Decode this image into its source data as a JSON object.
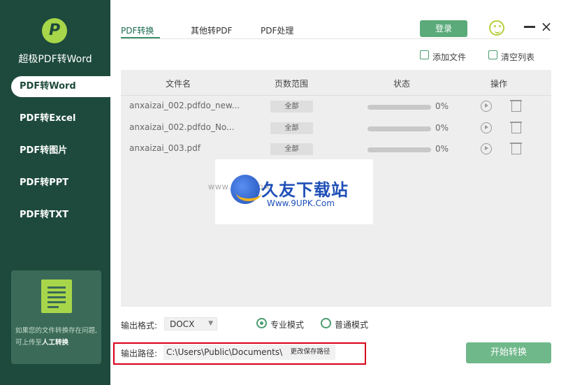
{
  "app": {
    "title": "超极PDF转Word",
    "logo_icon": "pdf-logo-icon",
    "brand_color": "#1d4a3c",
    "accent_color": "#5aaa7a"
  },
  "sidebar": {
    "items": [
      {
        "label": "PDF转Word",
        "active": true
      },
      {
        "label": "PDF转Excel",
        "active": false
      },
      {
        "label": "PDF转图片",
        "active": false
      },
      {
        "label": "PDF转PPT",
        "active": false
      },
      {
        "label": "PDF转TXT",
        "active": false
      }
    ],
    "promo": {
      "text": "如果您的文件转换存在问题,可上传至",
      "link": "人工转换",
      "icon": "document-icon"
    }
  },
  "header": {
    "tabs": [
      {
        "label": "PDF转换",
        "active": true
      },
      {
        "label": "其他转PDF",
        "active": false
      },
      {
        "label": "PDF处理",
        "active": false
      }
    ],
    "login_label": "登录",
    "feedback_icon": "smiley-icon",
    "minimize_icon": "minimize-icon",
    "close_icon": "close-icon"
  },
  "toolbar": {
    "add_file_label": "添加文件",
    "clear_list_label": "清空列表"
  },
  "table": {
    "columns": [
      "文件名",
      "页数范围",
      "状态",
      "操作"
    ],
    "rows": [
      {
        "name": "anxaizai_002.pdfdo_new...",
        "range": "全部",
        "progress": 0,
        "progress_text": "0%"
      },
      {
        "name": "anxaizai_002.pdfdo_No...",
        "range": "全部",
        "progress": 0,
        "progress_text": "0%"
      },
      {
        "name": "anxaizai_003.pdf",
        "range": "全部",
        "progress": 0,
        "progress_text": "0%"
      }
    ]
  },
  "watermark": {
    "left_text": "WWW.9UPK.COM",
    "main_text": "久友下载站",
    "sub_text": "Www.9UPK.Com"
  },
  "output": {
    "format_label": "输出格式:",
    "format_value": "DOCX",
    "mode_pro_label": "专业模式",
    "mode_normal_label": "普通模式",
    "selected_mode": "pro",
    "path_label": "输出路径:",
    "path_value": "C:\\Users\\Public\\Documents\\",
    "change_path_label": "更改保存路径"
  },
  "start_label": "开始转换"
}
